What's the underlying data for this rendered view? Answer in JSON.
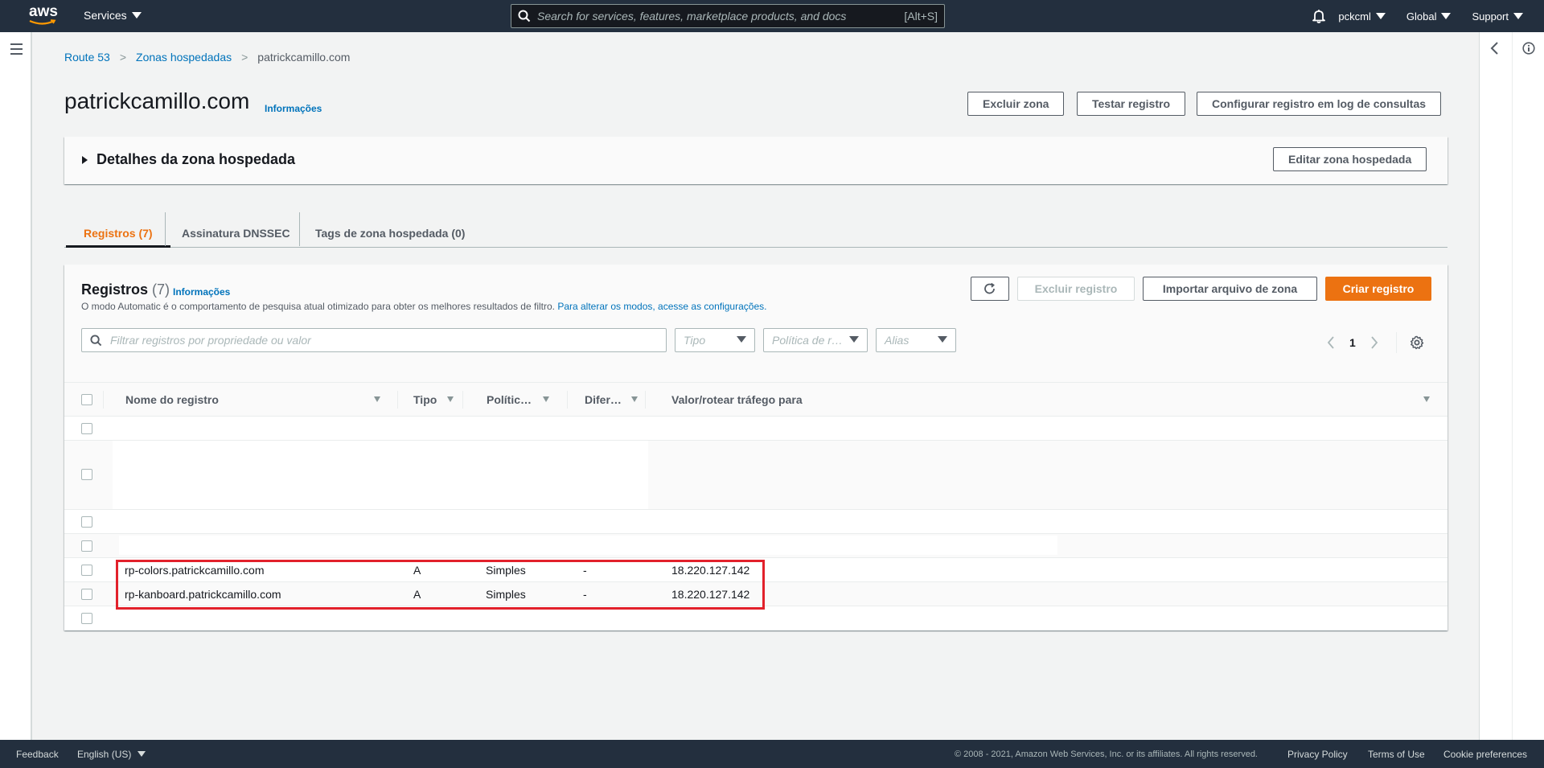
{
  "topnav": {
    "logo": "aws",
    "services": "Services",
    "search_placeholder": "Search for services, features, marketplace products, and docs",
    "search_shortcut": "[Alt+S]",
    "user": "pckcml",
    "region": "Global",
    "support": "Support"
  },
  "breadcrumb": [
    {
      "label": "Route 53"
    },
    {
      "label": "Zonas hospedadas"
    },
    {
      "label": "patrickcamillo.com"
    }
  ],
  "page": {
    "title": "patrickcamillo.com",
    "info_link": "Informações",
    "buttons": {
      "delete_zone": "Excluir zona",
      "test_record": "Testar registro",
      "configure_logging": "Configurar registro em log de consultas"
    }
  },
  "details": {
    "title": "Detalhes da zona hospedada",
    "edit_button": "Editar zona hospedada"
  },
  "tabs": [
    {
      "label": "Registros (7)",
      "active": true
    },
    {
      "label": "Assinatura DNSSEC",
      "active": false
    },
    {
      "label": "Tags de zona hospedada (0)",
      "active": false
    }
  ],
  "records": {
    "title": "Registros",
    "count": "(7)",
    "info_link": "Informações",
    "description": "O modo Automatic é o comportamento de pesquisa atual otimizado para obter os melhores resultados de filtro.",
    "description_link": "Para alterar os modos, acesse as configurações.",
    "buttons": {
      "delete": "Excluir registro",
      "import": "Importar arquivo de zona",
      "create": "Criar registro"
    },
    "filter_placeholder": "Filtrar registros por propriedade ou valor",
    "selects": {
      "type": "Tipo",
      "policy": "Política de r…",
      "alias": "Alias"
    },
    "page": "1",
    "columns": [
      "Nome do registro",
      "Tipo",
      "Polític…",
      "Difer…",
      "Valor/rotear tráfego para"
    ],
    "rows": [
      {
        "name": "",
        "type": "",
        "policy": "",
        "diff": "",
        "value": ""
      },
      {
        "name": "",
        "type": "",
        "policy": "",
        "diff": "",
        "value": ""
      },
      {
        "name": "",
        "type": "",
        "policy": "",
        "diff": "",
        "value": ""
      },
      {
        "name": "",
        "type": "",
        "policy": "",
        "diff": "",
        "value": ""
      },
      {
        "name": "rp-colors.patrickcamillo.com",
        "type": "A",
        "policy": "Simples",
        "diff": "-",
        "value": "18.220.127.142"
      },
      {
        "name": "rp-kanboard.patrickcamillo.com",
        "type": "A",
        "policy": "Simples",
        "diff": "-",
        "value": "18.220.127.142"
      },
      {
        "name": "",
        "type": "",
        "policy": "",
        "diff": "",
        "value": ""
      }
    ]
  },
  "footer": {
    "feedback": "Feedback",
    "language": "English (US)",
    "copyright": "© 2008 - 2021, Amazon Web Services, Inc. or its affiliates. All rights reserved.",
    "privacy": "Privacy Policy",
    "terms": "Terms of Use",
    "cookies": "Cookie preferences"
  },
  "colors": {
    "nav_bg": "#232f3e",
    "accent_orange": "#ec7211",
    "link_blue": "#0073bb",
    "highlight_red": "#e2212b"
  }
}
